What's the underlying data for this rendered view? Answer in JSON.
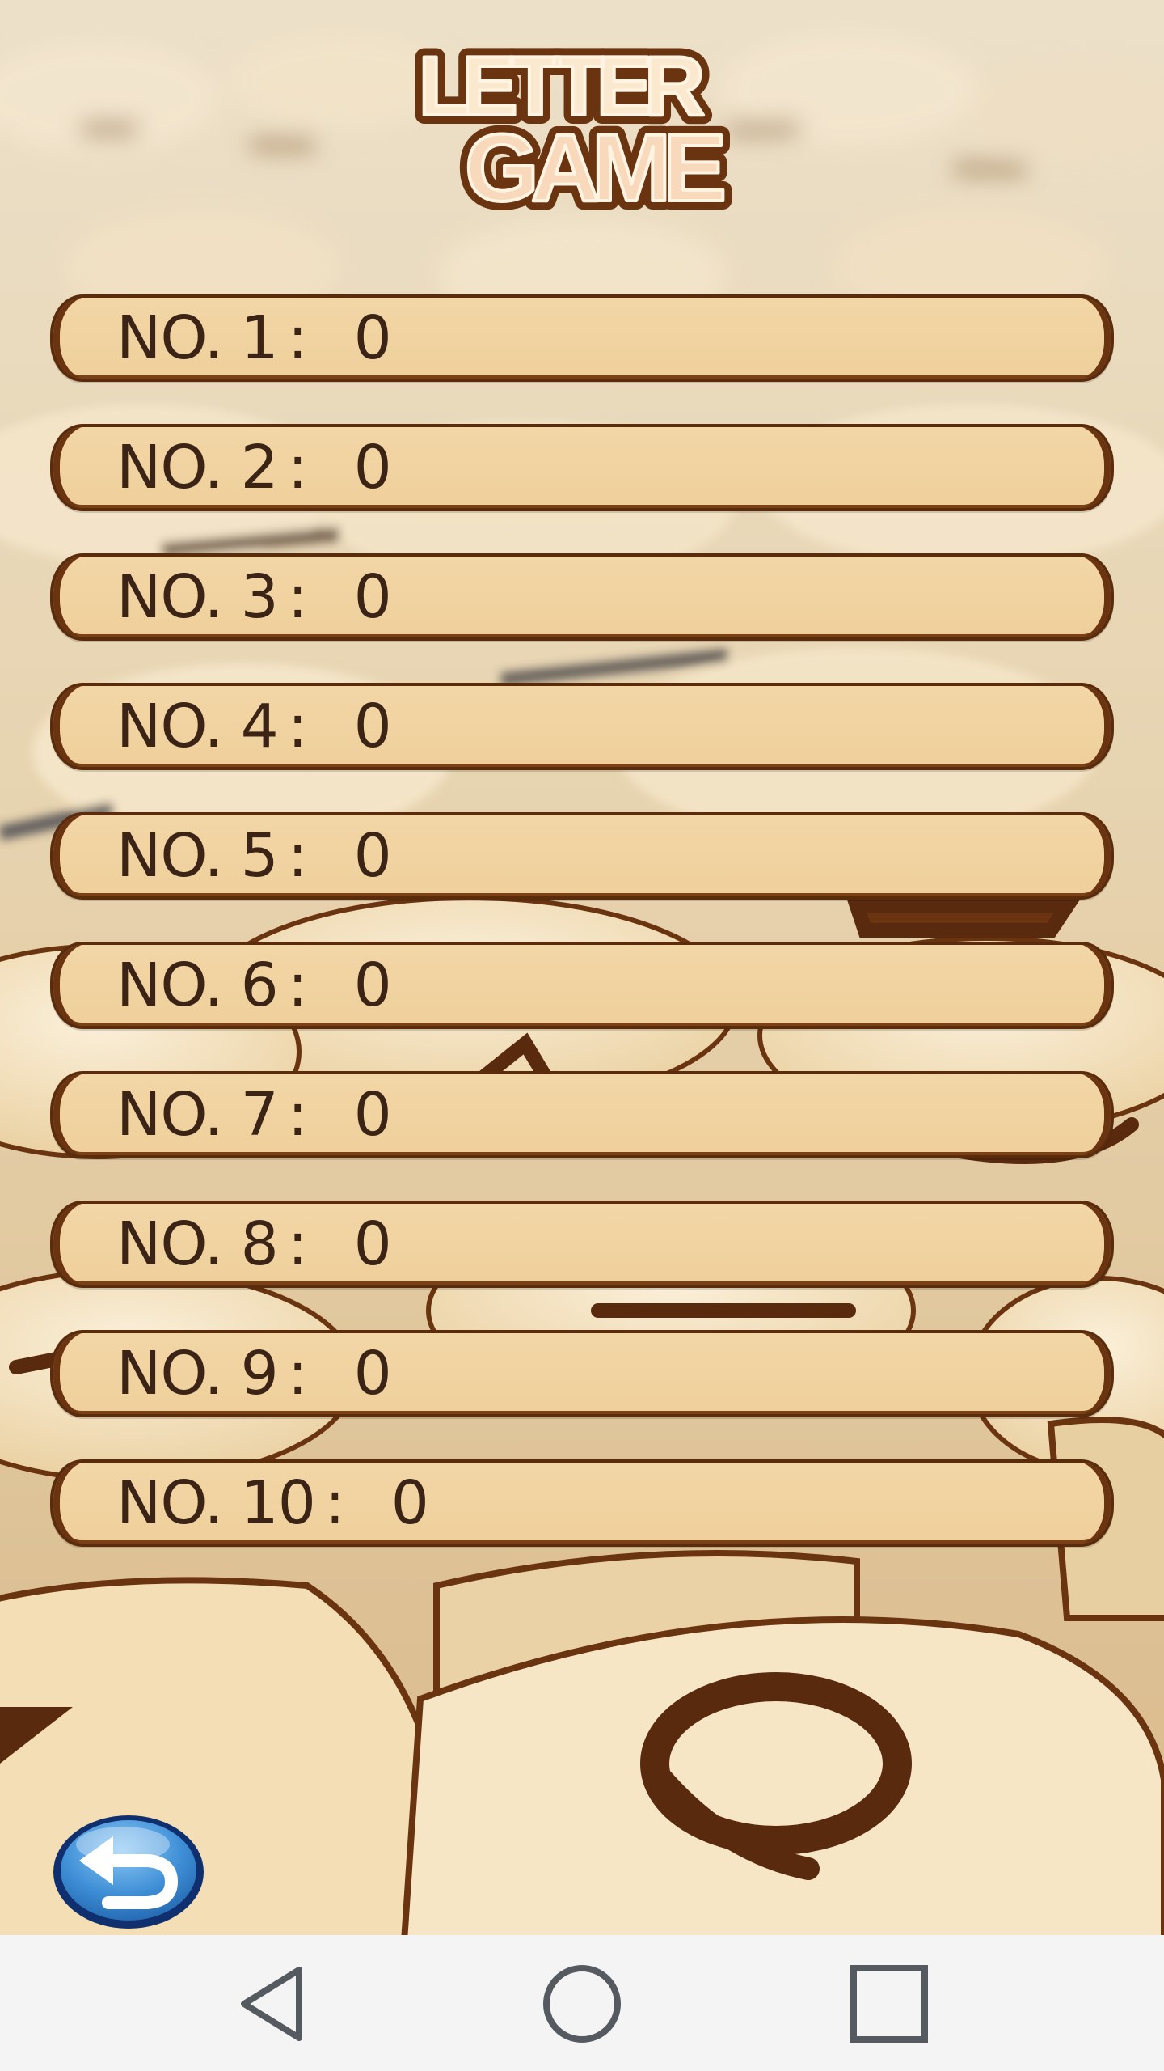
{
  "title": {
    "line1": "LETTER",
    "line2": "GAME"
  },
  "scores": [
    {
      "label": "NO. 1",
      "separator": ":",
      "value": "0"
    },
    {
      "label": "NO. 2",
      "separator": ":",
      "value": "0"
    },
    {
      "label": "NO. 3",
      "separator": ":",
      "value": "0"
    },
    {
      "label": "NO. 4",
      "separator": ":",
      "value": "0"
    },
    {
      "label": "NO. 5",
      "separator": ":",
      "value": "0"
    },
    {
      "label": "NO. 6",
      "separator": ":",
      "value": "0"
    },
    {
      "label": "NO. 7",
      "separator": ":",
      "value": "0"
    },
    {
      "label": "NO. 8",
      "separator": ":",
      "value": "0"
    },
    {
      "label": "NO. 9",
      "separator": ":",
      "value": "0"
    },
    {
      "label": "NO. 10",
      "separator": ":",
      "value": "0"
    }
  ],
  "back_button": {
    "icon": "back-arrow-icon"
  },
  "nav_bar": {
    "back_icon": "triangle-back-icon",
    "home_icon": "circle-home-icon",
    "recents_icon": "square-recents-icon"
  },
  "colors": {
    "row_fill": "#f0d29e",
    "row_border": "#5a2c0c",
    "row_text": "#3b2416",
    "title_fill": "#fbe9cf",
    "title_outline": "#6b3410",
    "back_button_blue": "#3f8fd6",
    "nav_bar_bg": "#f4f4f5",
    "nav_icon": "#555a60"
  }
}
